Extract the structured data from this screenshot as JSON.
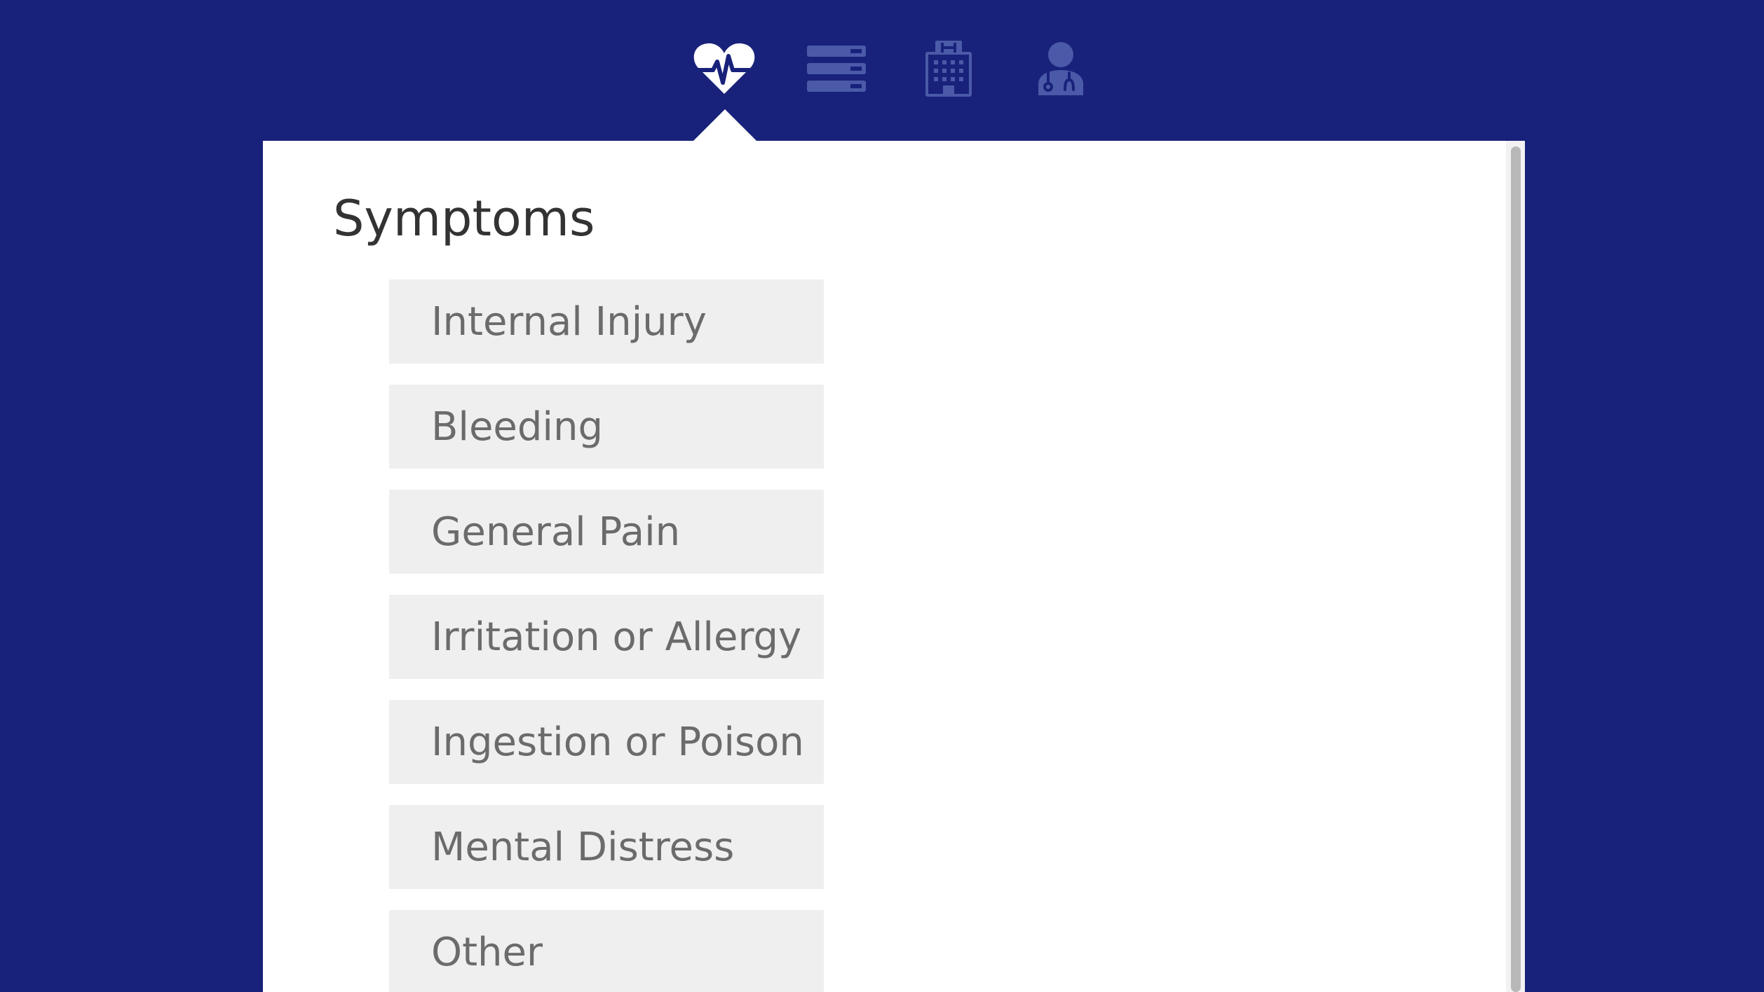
{
  "nav": {
    "items": [
      {
        "icon": "heartbeat-icon",
        "active": true
      },
      {
        "icon": "list-icon",
        "active": false
      },
      {
        "icon": "hospital-icon",
        "active": false
      },
      {
        "icon": "doctor-icon",
        "active": false
      }
    ]
  },
  "panel": {
    "title": "Symptoms",
    "options": [
      {
        "label": "Internal Injury"
      },
      {
        "label": "Bleeding"
      },
      {
        "label": "General Pain"
      },
      {
        "label": "Irritation or Allergy"
      },
      {
        "label": "Ingestion or Poison"
      },
      {
        "label": "Mental Distress"
      },
      {
        "label": "Other"
      }
    ]
  },
  "colors": {
    "background": "#19227a",
    "icon_active": "#ffffff",
    "icon_inactive": "#4a5aa8",
    "option_bg": "#efefef",
    "option_text": "#6b6b6b",
    "title_text": "#333333"
  }
}
